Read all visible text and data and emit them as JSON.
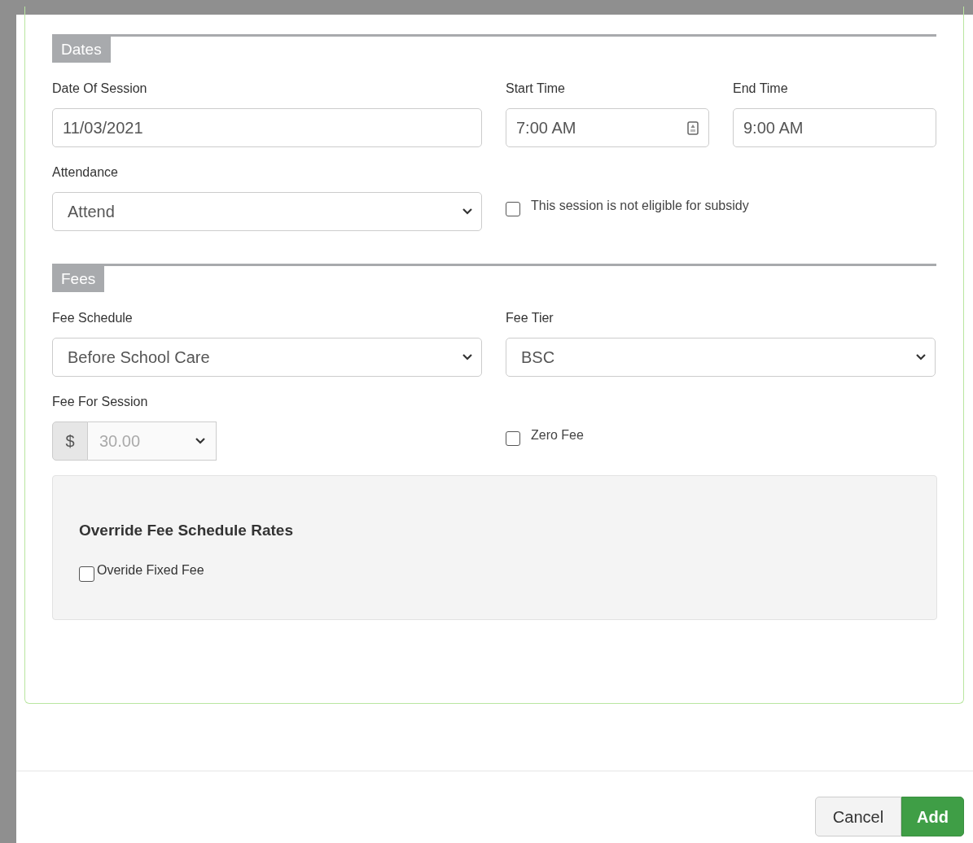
{
  "sections": [
    {
      "title": "Dates",
      "rows": [
        [
          {
            "kind": "text",
            "label": "Date Of Session",
            "value": "11/03/2021"
          },
          {
            "kind": "time",
            "label": "Start Time",
            "value": "7:00 AM"
          },
          {
            "kind": "text",
            "label": "End Time",
            "value": "9:00 AM"
          }
        ],
        [
          {
            "kind": "select",
            "label": "Attendance",
            "value": "Attend"
          },
          {
            "kind": "checkbox",
            "label": "This session is not eligible for subsidy",
            "checked": false
          }
        ]
      ]
    },
    {
      "title": "Fees",
      "rows": [
        [
          {
            "kind": "select",
            "label": "Fee Schedule",
            "value": "Before School Care"
          },
          {
            "kind": "select",
            "label": "Fee Tier",
            "value": "BSC"
          }
        ],
        [
          {
            "kind": "currency",
            "label": "Fee For Session",
            "prefix": "$",
            "value": "30.00",
            "disabled": true
          },
          {
            "kind": "checkbox",
            "label": "Zero Fee",
            "checked": false
          }
        ]
      ]
    }
  ],
  "override": {
    "title": "Override Fee Schedule Rates",
    "checkbox": {
      "label": "Overide Fixed Fee",
      "checked": false
    }
  },
  "buttons": [
    {
      "label": "Cancel",
      "kind": "default"
    },
    {
      "label": "Add",
      "kind": "primary"
    }
  ]
}
